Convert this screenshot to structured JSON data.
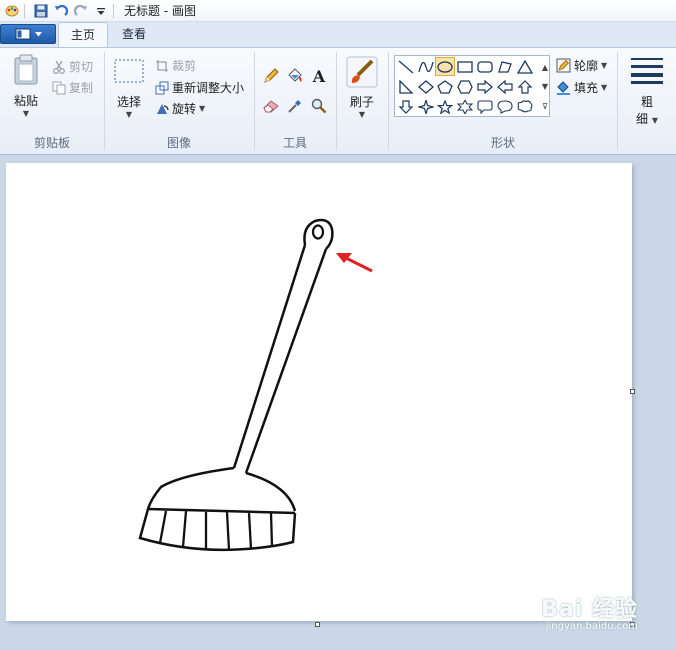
{
  "titlebar": {
    "title": "无标题 - 画图"
  },
  "tabs": {
    "home": "主页",
    "view": "查看"
  },
  "clipboard": {
    "paste": "粘贴",
    "cut": "剪切",
    "copy": "复制",
    "label": "剪贴板"
  },
  "image": {
    "select": "选择",
    "crop": "裁剪",
    "resize": "重新调整大小",
    "rotate": "旋转",
    "label": "图像"
  },
  "tools": {
    "label": "工具",
    "text_tool": "A"
  },
  "brushes": {
    "label": "刷子"
  },
  "shapes": {
    "label": "形状",
    "outline": "轮廓",
    "fill": "填充"
  },
  "size": {
    "label_line1": "粗",
    "label_line2": "细"
  },
  "watermark": {
    "main": "Bai 经验",
    "sub": "jingyan.baidu.com"
  },
  "colors": {
    "accent_arrow": "#e02020",
    "ribbon_bg": "#f3f6fb",
    "workspace": "#cbd7e7"
  }
}
